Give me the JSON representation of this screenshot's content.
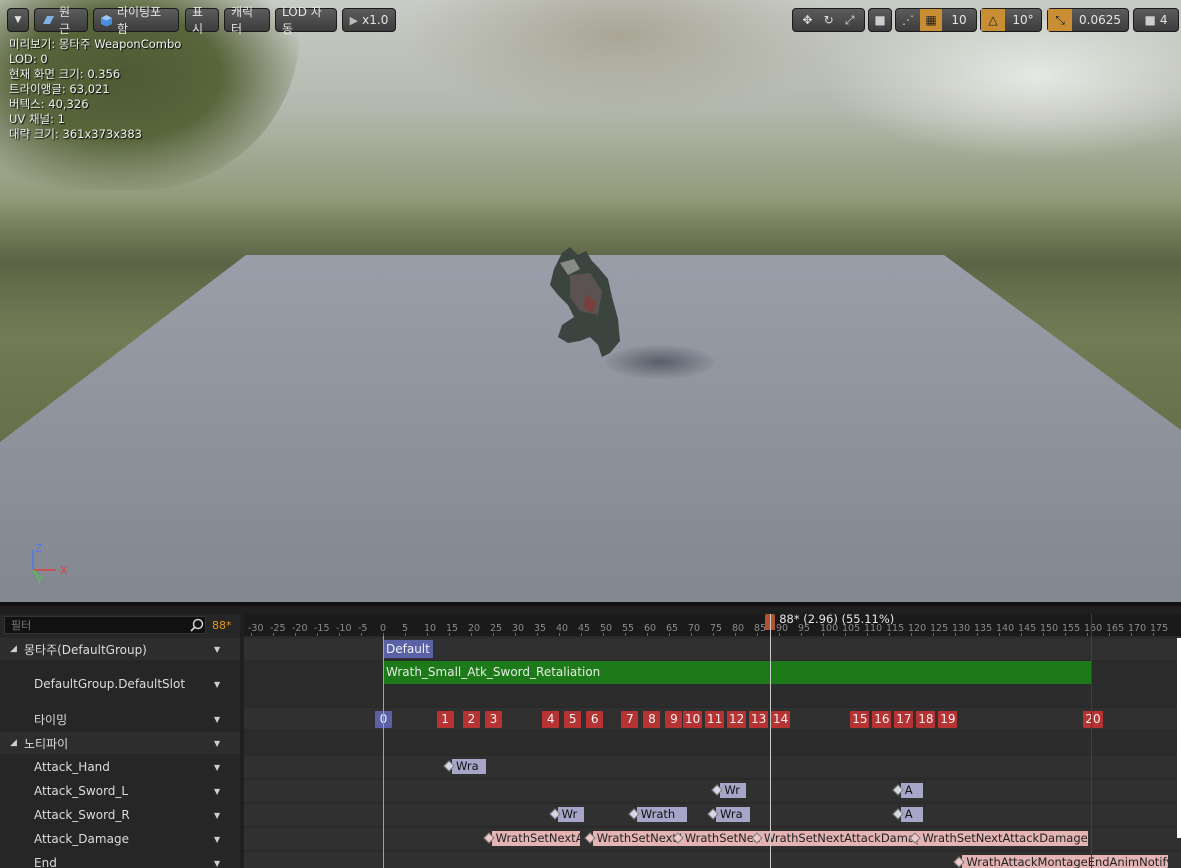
{
  "toolbar": {
    "dropdown_label": "",
    "perspective_label": "원근",
    "lighting_label": "라이팅포함",
    "show_label": "표시",
    "character_label": "캐릭터",
    "lod_label": "LOD 자동",
    "speed_label": "x1.0",
    "grid_value": "10",
    "rotation_value": "10°",
    "scale_value": "0.0625",
    "camera_speed_value": "4"
  },
  "stats": {
    "preview": "미리보기: 몽타주 WeaponCombo",
    "lod": "LOD: 0",
    "screen_size": "현재 화면 크기: 0.356",
    "triangles": "트라이앵글: 63,021",
    "vertices": "버텍스: 40,326",
    "uv_channels": "UV 채널: 1",
    "approx_size": "대략 크기: 361x373x383"
  },
  "gizmo": {
    "z": "Z",
    "y": "Y",
    "x": "X"
  },
  "panel": {
    "filter_placeholder": "필터",
    "frame_count": "88*",
    "rows": {
      "montage_group": "몽타주(DefaultGroup)",
      "slot": "DefaultGroup.DefaultSlot",
      "timing": "타이밍",
      "notifies": "노티파이",
      "attack_hand": "Attack_Hand",
      "attack_sword_l": "Attack_Sword_L",
      "attack_sword_r": "Attack_Sword_R",
      "attack_damage": "Attack_Damage",
      "end": "End"
    }
  },
  "timeline": {
    "ticks": [
      "-30",
      "-25",
      "-20",
      "-15",
      "-10",
      "-5",
      "0",
      "5",
      "10",
      "15",
      "20",
      "25",
      "30",
      "35",
      "40",
      "45",
      "50",
      "55",
      "60",
      "65",
      "70",
      "75",
      "80",
      "85",
      "90",
      "95",
      "100",
      "105",
      "110",
      "115",
      "120",
      "125",
      "130",
      "135",
      "140",
      "145",
      "150",
      "155",
      "160",
      "165",
      "170",
      "175"
    ],
    "playhead_label": "88* (2.96) (55.11%)",
    "section_label": "Default",
    "anim_label": "Wrath_Small_Atk_Sword_Retaliation",
    "timing_markers": [
      {
        "label": "0",
        "frame": 0,
        "type": "blue"
      },
      {
        "label": "1",
        "frame": 14
      },
      {
        "label": "2",
        "frame": 20
      },
      {
        "label": "3",
        "frame": 25
      },
      {
        "label": "4",
        "frame": 38
      },
      {
        "label": "5",
        "frame": 43
      },
      {
        "label": "6",
        "frame": 48
      },
      {
        "label": "7",
        "frame": 56
      },
      {
        "label": "8",
        "frame": 61
      },
      {
        "label": "9",
        "frame": 66
      },
      {
        "label": "10",
        "frame": 70
      },
      {
        "label": "11",
        "frame": 75
      },
      {
        "label": "12",
        "frame": 80
      },
      {
        "label": "13",
        "frame": 85
      },
      {
        "label": "14",
        "frame": 90
      },
      {
        "label": "15",
        "frame": 108
      },
      {
        "label": "16",
        "frame": 113
      },
      {
        "label": "17",
        "frame": 118
      },
      {
        "label": "18",
        "frame": 123
      },
      {
        "label": "19",
        "frame": 128
      },
      {
        "label": "20",
        "frame": 161
      }
    ],
    "notifies": {
      "hand": [
        {
          "label": "Wra",
          "frame": 15
        }
      ],
      "sword_l": [
        {
          "label": "Wr",
          "frame": 76
        },
        {
          "label": "A",
          "frame": 117
        }
      ],
      "sword_r": [
        {
          "label": "Wr",
          "frame": 39
        },
        {
          "label": "Wrath",
          "frame": 57
        },
        {
          "label": "Wra",
          "frame": 75
        },
        {
          "label": "A",
          "frame": 117
        }
      ],
      "damage": [
        {
          "label": "WrathSetNextAttack",
          "frame": 24
        },
        {
          "label": "WrathSetNextAttack",
          "frame": 47
        },
        {
          "label": "WrathSetNextAttack",
          "frame": 67
        },
        {
          "label": "WrathSetNextAttackDamage",
          "frame": 85
        },
        {
          "label": "WrathSetNextAttackDamage",
          "frame": 121
        }
      ],
      "end": [
        {
          "label": "WrathAttackMontageEndAnimNotify",
          "frame": 131
        }
      ]
    }
  },
  "colors": {
    "timing_red": "#b53333",
    "section_blue": "#5a61a6",
    "anim_green": "#1d7a18",
    "frame_orange": "#e39522"
  }
}
